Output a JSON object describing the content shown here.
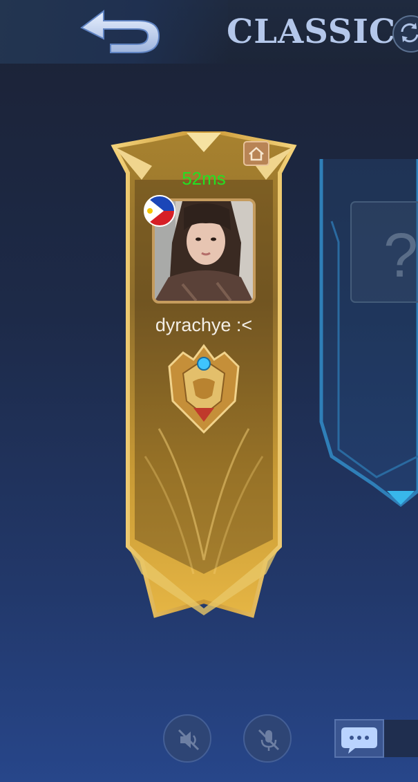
{
  "header": {
    "mode_title": "CLASSIC",
    "back_icon": "back-arrow-icon",
    "refresh_icon": "refresh-icon"
  },
  "player_slot": {
    "ping": "52ms",
    "ping_color": "#23e023",
    "name": "dyrachye :<",
    "country_flag": "philippines-flag-icon",
    "home_icon": "home-icon",
    "rank_icon": "rank-emblem-icon",
    "banner_color": "#d8a83a"
  },
  "empty_slot": {
    "placeholder": "?"
  },
  "controls": {
    "speaker_icon": "speaker-muted-icon",
    "mic_icon": "mic-muted-icon",
    "chat_icon": "chat-icon"
  }
}
